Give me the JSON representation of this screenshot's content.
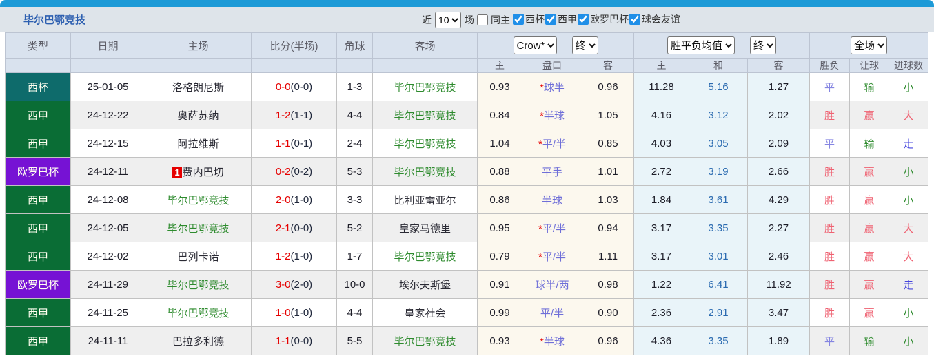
{
  "toolbar": {
    "team_name": "毕尔巴鄂竞技",
    "recent_label": "近",
    "recent_value": "10",
    "games_label": "场",
    "same_home": {
      "label": "同主",
      "checked": false
    },
    "filters": [
      {
        "label": "西杯",
        "checked": true
      },
      {
        "label": "西甲",
        "checked": true
      },
      {
        "label": "欧罗巴杯",
        "checked": true
      },
      {
        "label": "球会友谊",
        "checked": true
      }
    ]
  },
  "header": {
    "columns": [
      "类型",
      "日期",
      "主场",
      "比分(半场)",
      "角球",
      "客场"
    ],
    "odds_source_select": "Crow*",
    "odds_time_select": "终",
    "avg_select": "胜平负均值",
    "avg_time_select": "终",
    "scope_select": "全场",
    "sub_columns": [
      "主",
      "盘口",
      "客",
      "主",
      "和",
      "客",
      "胜负",
      "让球",
      "进球数"
    ]
  },
  "palette": {
    "accent_bar": "#1d9ad7",
    "toolbar_bg": "#dee4ea",
    "header_bg": "#d9e2ee",
    "score_red": "#e60000",
    "team_green": "#2e8b2e",
    "opponent_dark": "#2a2a34",
    "handicap_blue": "#6f6fd8",
    "avg_mid_blue": "#2a6ab0",
    "win": "#ef6272",
    "draw": "#8585e2",
    "lose": "#2e8b2e",
    "walk": "#4545dd",
    "league": {
      "西杯": "#0e6b6b",
      "西甲": "#0a6d35",
      "欧罗巴杯": "#7612d4"
    }
  },
  "rows": [
    {
      "type": "西杯",
      "date": "25-01-05",
      "home": "洛格朗尼斯",
      "home_team": false,
      "badge": "",
      "score": "0-0",
      "half": "(0-0)",
      "corner": "1-3",
      "away": "毕尔巴鄂竞技",
      "away_team": true,
      "odds_home": "0.93",
      "handicap": "*球半",
      "odds_away": "0.96",
      "avg_home": "11.28",
      "avg_draw": "5.16",
      "avg_away": "1.27",
      "res_outcome": {
        "text": "平",
        "key": "draw"
      },
      "res_handicap": {
        "text": "输",
        "key": "lose"
      },
      "res_goals": {
        "text": "小",
        "key": "lose"
      }
    },
    {
      "type": "西甲",
      "date": "24-12-22",
      "home": "奥萨苏纳",
      "home_team": false,
      "badge": "",
      "score": "1-2",
      "half": "(1-1)",
      "corner": "4-4",
      "away": "毕尔巴鄂竞技",
      "away_team": true,
      "odds_home": "0.84",
      "handicap": "*半球",
      "odds_away": "1.05",
      "avg_home": "4.16",
      "avg_draw": "3.12",
      "avg_away": "2.02",
      "res_outcome": {
        "text": "胜",
        "key": "win"
      },
      "res_handicap": {
        "text": "赢",
        "key": "win"
      },
      "res_goals": {
        "text": "大",
        "key": "win"
      }
    },
    {
      "type": "西甲",
      "date": "24-12-15",
      "home": "阿拉维斯",
      "home_team": false,
      "badge": "",
      "score": "1-1",
      "half": "(0-1)",
      "corner": "2-4",
      "away": "毕尔巴鄂竞技",
      "away_team": true,
      "odds_home": "1.04",
      "handicap": "*平/半",
      "odds_away": "0.85",
      "avg_home": "4.03",
      "avg_draw": "3.05",
      "avg_away": "2.09",
      "res_outcome": {
        "text": "平",
        "key": "draw"
      },
      "res_handicap": {
        "text": "输",
        "key": "lose"
      },
      "res_goals": {
        "text": "走",
        "key": "walk"
      }
    },
    {
      "type": "欧罗巴杯",
      "date": "24-12-11",
      "home": "费内巴切",
      "home_team": false,
      "badge": "1",
      "score": "0-2",
      "half": "(0-2)",
      "corner": "5-3",
      "away": "毕尔巴鄂竞技",
      "away_team": true,
      "odds_home": "0.88",
      "handicap": "平手",
      "odds_away": "1.01",
      "avg_home": "2.72",
      "avg_draw": "3.19",
      "avg_away": "2.66",
      "res_outcome": {
        "text": "胜",
        "key": "win"
      },
      "res_handicap": {
        "text": "赢",
        "key": "win"
      },
      "res_goals": {
        "text": "小",
        "key": "lose"
      }
    },
    {
      "type": "西甲",
      "date": "24-12-08",
      "home": "毕尔巴鄂竞技",
      "home_team": true,
      "badge": "",
      "score": "2-0",
      "half": "(1-0)",
      "corner": "3-3",
      "away": "比利亚雷亚尔",
      "away_team": false,
      "odds_home": "0.86",
      "handicap": "半球",
      "odds_away": "1.03",
      "avg_home": "1.84",
      "avg_draw": "3.61",
      "avg_away": "4.29",
      "res_outcome": {
        "text": "胜",
        "key": "win"
      },
      "res_handicap": {
        "text": "赢",
        "key": "win"
      },
      "res_goals": {
        "text": "小",
        "key": "lose"
      }
    },
    {
      "type": "西甲",
      "date": "24-12-05",
      "home": "毕尔巴鄂竞技",
      "home_team": true,
      "badge": "",
      "score": "2-1",
      "half": "(0-0)",
      "corner": "5-2",
      "away": "皇家马德里",
      "away_team": false,
      "odds_home": "0.95",
      "handicap": "*平/半",
      "odds_away": "0.94",
      "avg_home": "3.17",
      "avg_draw": "3.35",
      "avg_away": "2.27",
      "res_outcome": {
        "text": "胜",
        "key": "win"
      },
      "res_handicap": {
        "text": "赢",
        "key": "win"
      },
      "res_goals": {
        "text": "大",
        "key": "win"
      }
    },
    {
      "type": "西甲",
      "date": "24-12-02",
      "home": "巴列卡诺",
      "home_team": false,
      "badge": "",
      "score": "1-2",
      "half": "(1-0)",
      "corner": "1-7",
      "away": "毕尔巴鄂竞技",
      "away_team": true,
      "odds_home": "0.79",
      "handicap": "*平/半",
      "odds_away": "1.11",
      "avg_home": "3.17",
      "avg_draw": "3.01",
      "avg_away": "2.46",
      "res_outcome": {
        "text": "胜",
        "key": "win"
      },
      "res_handicap": {
        "text": "赢",
        "key": "win"
      },
      "res_goals": {
        "text": "大",
        "key": "win"
      }
    },
    {
      "type": "欧罗巴杯",
      "date": "24-11-29",
      "home": "毕尔巴鄂竞技",
      "home_team": true,
      "badge": "",
      "score": "3-0",
      "half": "(2-0)",
      "corner": "10-0",
      "away": "埃尔夫斯堡",
      "away_team": false,
      "odds_home": "0.91",
      "handicap": "球半/两",
      "odds_away": "0.98",
      "avg_home": "1.22",
      "avg_draw": "6.41",
      "avg_away": "11.92",
      "res_outcome": {
        "text": "胜",
        "key": "win"
      },
      "res_handicap": {
        "text": "赢",
        "key": "win"
      },
      "res_goals": {
        "text": "走",
        "key": "walk"
      }
    },
    {
      "type": "西甲",
      "date": "24-11-25",
      "home": "毕尔巴鄂竞技",
      "home_team": true,
      "badge": "",
      "score": "1-0",
      "half": "(1-0)",
      "corner": "4-4",
      "away": "皇家社会",
      "away_team": false,
      "odds_home": "0.99",
      "handicap": "平/半",
      "odds_away": "0.90",
      "avg_home": "2.36",
      "avg_draw": "2.91",
      "avg_away": "3.47",
      "res_outcome": {
        "text": "胜",
        "key": "win"
      },
      "res_handicap": {
        "text": "赢",
        "key": "win"
      },
      "res_goals": {
        "text": "小",
        "key": "lose"
      }
    },
    {
      "type": "西甲",
      "date": "24-11-11",
      "home": "巴拉多利德",
      "home_team": false,
      "badge": "",
      "score": "1-1",
      "half": "(0-0)",
      "corner": "5-5",
      "away": "毕尔巴鄂竞技",
      "away_team": true,
      "odds_home": "0.93",
      "handicap": "*半球",
      "odds_away": "0.96",
      "avg_home": "4.36",
      "avg_draw": "3.35",
      "avg_away": "1.89",
      "res_outcome": {
        "text": "平",
        "key": "draw"
      },
      "res_handicap": {
        "text": "输",
        "key": "lose"
      },
      "res_goals": {
        "text": "小",
        "key": "lose"
      }
    }
  ]
}
